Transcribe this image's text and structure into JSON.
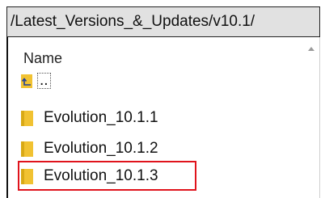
{
  "path": "/Latest_Versions_&_Updates/v10.1/",
  "columns": {
    "name": "Name"
  },
  "parent_entry": {
    "label": "..",
    "icon": "up-folder-icon"
  },
  "entries": [
    {
      "label": "Evolution_10.1.1",
      "icon": "folder-icon"
    },
    {
      "label": "Evolution_10.1.2",
      "icon": "folder-icon"
    },
    {
      "label": "Evolution_10.1.3",
      "icon": "folder-icon",
      "highlighted": true
    }
  ],
  "colors": {
    "folder": "#f1c232",
    "highlight": "#e0131c",
    "pathbar_bg": "#e1e1e1"
  }
}
